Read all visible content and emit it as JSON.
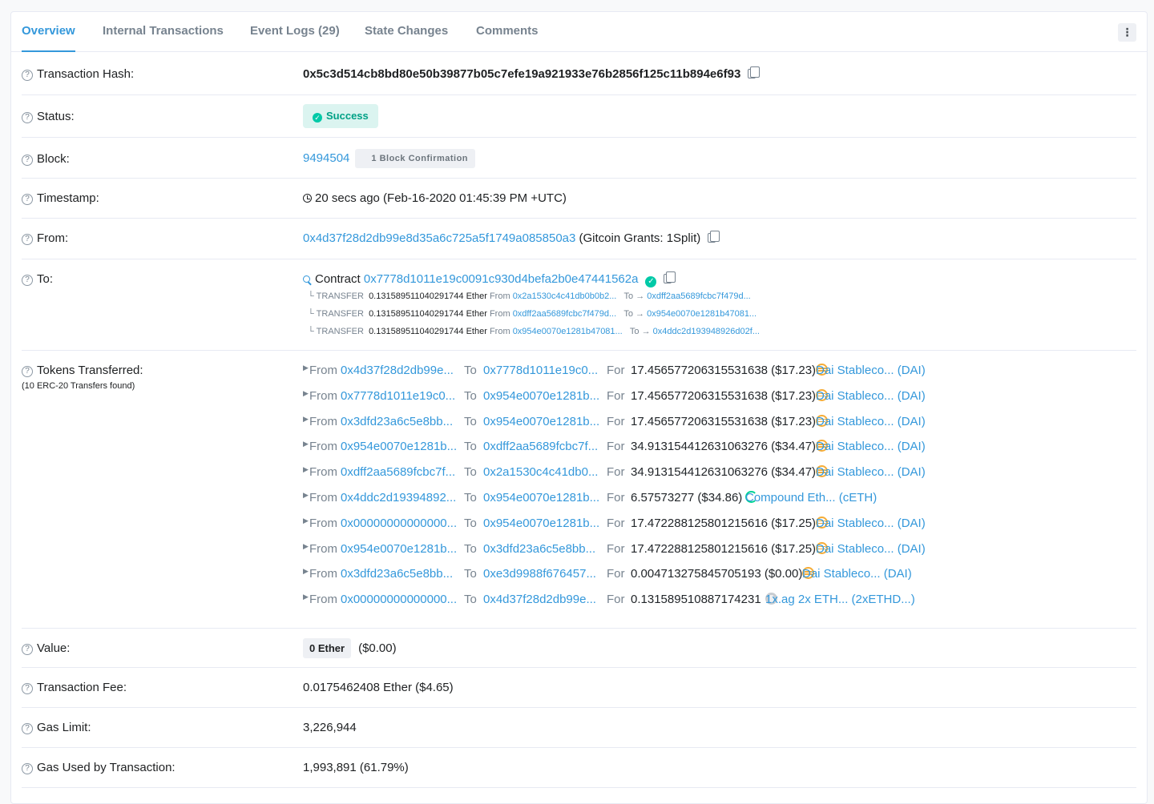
{
  "tabs": [
    {
      "label": "Overview"
    },
    {
      "label": "Internal Transactions"
    },
    {
      "label": "Event Logs (29)"
    },
    {
      "label": "State Changes"
    },
    {
      "label": "Comments"
    }
  ],
  "more_icon": "⋮",
  "hash": {
    "label": "Transaction Hash:",
    "value": "0x5c3d514cb8bd80e50b39877b05c7efe19a921933e76b2856f125c11b894e6f93"
  },
  "status": {
    "label": "Status:",
    "value": "Success",
    "color": "#00c9a7"
  },
  "block": {
    "label": "Block:",
    "number": "9494504",
    "confirmations": "1 Block Confirmation"
  },
  "timestamp": {
    "label": "Timestamp:",
    "value": "20 secs ago (Feb-16-2020 01:45:39 PM +UTC)"
  },
  "from": {
    "label": "From:",
    "address": "0x4d37f28d2db99e8d35a6c725a5f1749a085850a3",
    "name": "(Gitcoin Grants: 1Split)"
  },
  "to": {
    "label": "To:",
    "prefix": "Contract",
    "address": "0x7778d1011e19c0091c930d4befa2b0e47441562a",
    "traces": [
      {
        "type": "└ TRANSFER",
        "amount": "0.131589511040291744 Ether",
        "from_label": "From",
        "from": "0x2a1530c4c41db0b0b2...",
        "to_label": "To →",
        "to": "0xdff2aa5689fcbc7f479d..."
      },
      {
        "type": "└ TRANSFER",
        "amount": "0.131589511040291744 Ether",
        "from_label": "From",
        "from": "0xdff2aa5689fcbc7f479d...",
        "to_label": "To →",
        "to": "0x954e0070e1281b47081..."
      },
      {
        "type": "└ TRANSFER",
        "amount": "0.131589511040291744 Ether",
        "from_label": "From",
        "from": "0x954e0070e1281b47081...",
        "to_label": "To →",
        "to": "0x4ddc2d193948926d02f..."
      }
    ]
  },
  "tokens": {
    "label": "Tokens Transferred:",
    "sublabel": "(10 ERC-20 Transfers found)",
    "from_label": "From",
    "to_label": "To",
    "for_label": "For",
    "rows": [
      {
        "from": "0x4d37f28d2db99e...",
        "to": "0x7778d1011e19c0...",
        "amount": "17.456577206315531638 ($17.23)",
        "token": "Dai Stableco... (DAI)",
        "icon": "dai"
      },
      {
        "from": "0x7778d1011e19c0...",
        "to": "0x954e0070e1281b...",
        "amount": "17.456577206315531638 ($17.23)",
        "token": "Dai Stableco... (DAI)",
        "icon": "dai"
      },
      {
        "from": "0x3dfd23a6c5e8bb...",
        "to": "0x954e0070e1281b...",
        "amount": "17.456577206315531638 ($17.23)",
        "token": "Dai Stableco... (DAI)",
        "icon": "dai"
      },
      {
        "from": "0x954e0070e1281b...",
        "to": "0xdff2aa5689fcbc7f...",
        "amount": "34.913154412631063276 ($34.47)",
        "token": "Dai Stableco... (DAI)",
        "icon": "dai"
      },
      {
        "from": "0xdff2aa5689fcbc7f...",
        "to": "0x2a1530c4c41db0...",
        "amount": "34.913154412631063276 ($34.47)",
        "token": "Dai Stableco... (DAI)",
        "icon": "dai"
      },
      {
        "from": "0x4ddc2d19394892...",
        "to": "0x954e0070e1281b...",
        "amount": "6.57573277 ($34.86)",
        "token": "Compound Eth... (cETH)",
        "icon": "ceth"
      },
      {
        "from": "0x00000000000000...",
        "to": "0x954e0070e1281b...",
        "amount": "17.472288125801215616 ($17.25)",
        "token": "Dai Stableco... (DAI)",
        "icon": "dai"
      },
      {
        "from": "0x954e0070e1281b...",
        "to": "0x3dfd23a6c5e8bb...",
        "amount": "17.472288125801215616 ($17.25)",
        "token": "Dai Stableco... (DAI)",
        "icon": "dai"
      },
      {
        "from": "0x3dfd23a6c5e8bb...",
        "to": "0xe3d9988f676457...",
        "amount": "0.004713275845705193 ($0.00)",
        "token": "Dai Stableco... (DAI)",
        "icon": "dai"
      },
      {
        "from": "0x00000000000000...",
        "to": "0x4d37f28d2db99e...",
        "amount": "0.131589510887174231",
        "token": "1x.ag 2x ETH... (2xETHD...)",
        "icon": "ethd"
      }
    ]
  },
  "value": {
    "label": "Value:",
    "amount": "0 Ether",
    "usd": "($0.00)"
  },
  "fee": {
    "label": "Transaction Fee:",
    "value": "0.0175462408 Ether ($4.65)"
  },
  "gas_limit": {
    "label": "Gas Limit:",
    "value": "3,226,944"
  },
  "gas_used": {
    "label": "Gas Used by Transaction:",
    "value": "1,993,891 (61.79%)"
  },
  "help_icon": "?"
}
